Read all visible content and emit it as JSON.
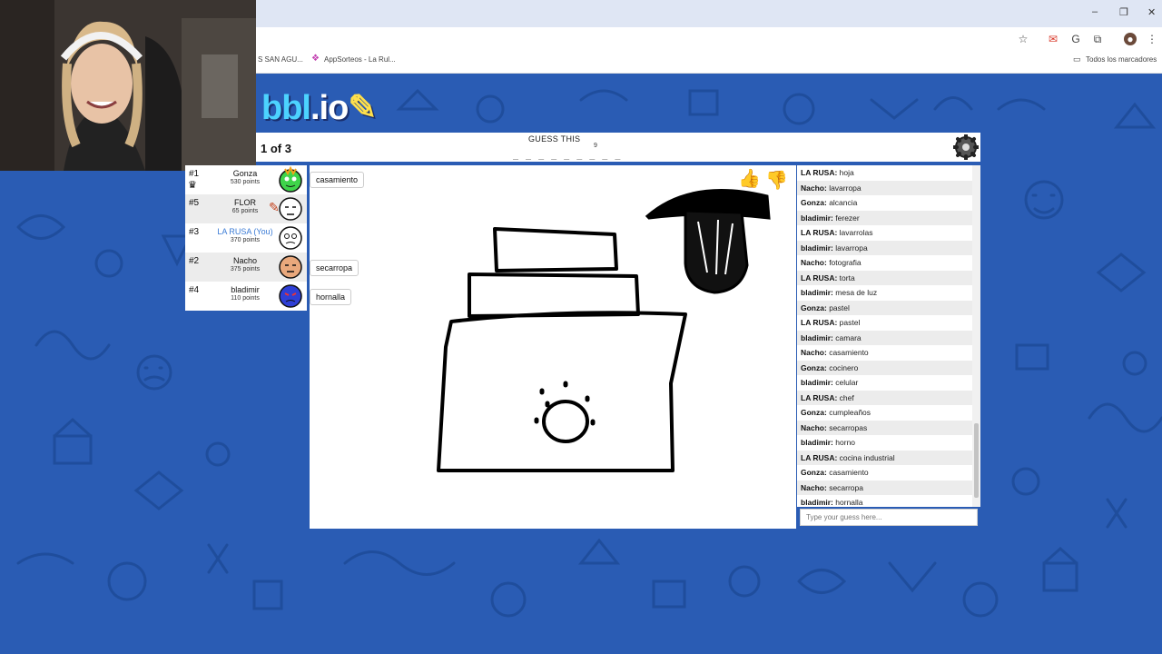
{
  "browser": {
    "bookmarks": [
      {
        "label": "S SAN AGU..."
      },
      {
        "label": "AppSorteos - La Rul..."
      }
    ],
    "all_bookmarks": "Todos los marcadores",
    "window_controls": [
      "–",
      "❐",
      "✕"
    ]
  },
  "game": {
    "logo": {
      "part1": "bbl",
      "part2": ".io"
    },
    "round": "1 of 3",
    "guess_label": "GUESS THIS",
    "hint": "_ _ _ _ _ _ _ _ _",
    "hint_count": "9"
  },
  "players": [
    {
      "rank": "#1",
      "name": "Gonza",
      "points": "530 points",
      "you": false,
      "color": "#3fd44a"
    },
    {
      "rank": "#5",
      "name": "FLOR",
      "points": "65 points",
      "you": false,
      "color": "#ffffff"
    },
    {
      "rank": "#3",
      "name": "LA RUSA (You)",
      "points": "370 points",
      "you": true,
      "color": "#ffffff"
    },
    {
      "rank": "#2",
      "name": "Nacho",
      "points": "375 points",
      "you": false,
      "color": "#e9a87c"
    },
    {
      "rank": "#4",
      "name": "bladimir",
      "points": "110 points",
      "you": false,
      "color": "#2e3fd6"
    }
  ],
  "bubbles": [
    {
      "text": "casamiento"
    },
    {
      "text": "secarropa"
    },
    {
      "text": "hornalla"
    }
  ],
  "chat": [
    {
      "name": "LA RUSA:",
      "text": "hoja"
    },
    {
      "name": "Nacho:",
      "text": "lavarropa"
    },
    {
      "name": "Gonza:",
      "text": "alcancia"
    },
    {
      "name": "bladimir:",
      "text": "ferezer"
    },
    {
      "name": "LA RUSA:",
      "text": "lavarrolas"
    },
    {
      "name": "bladimir:",
      "text": "lavarropa"
    },
    {
      "name": "Nacho:",
      "text": "fotografia"
    },
    {
      "name": "LA RUSA:",
      "text": "torta"
    },
    {
      "name": "bladimir:",
      "text": "mesa de luz"
    },
    {
      "name": "Gonza:",
      "text": "pastel"
    },
    {
      "name": "LA RUSA:",
      "text": "pastel"
    },
    {
      "name": "bladimir:",
      "text": "camara"
    },
    {
      "name": "Nacho:",
      "text": "casamiento"
    },
    {
      "name": "Gonza:",
      "text": "cocinero"
    },
    {
      "name": "bladimir:",
      "text": "celular"
    },
    {
      "name": "LA RUSA:",
      "text": "chef"
    },
    {
      "name": "Gonza:",
      "text": "cumpleaños"
    },
    {
      "name": "Nacho:",
      "text": "secarropas"
    },
    {
      "name": "bladimir:",
      "text": "horno"
    },
    {
      "name": "LA RUSA:",
      "text": "cocina industrial"
    },
    {
      "name": "Gonza:",
      "text": "casamiento"
    },
    {
      "name": "Nacho:",
      "text": "secarropa"
    },
    {
      "name": "bladimir:",
      "text": "hornalla"
    }
  ],
  "chat_input": {
    "placeholder": "Type your guess here..."
  },
  "colors": {
    "background": "#2a5cb4",
    "you": "#3a7bd5",
    "like": "#5fc83f",
    "dislike": "#e0566b"
  }
}
